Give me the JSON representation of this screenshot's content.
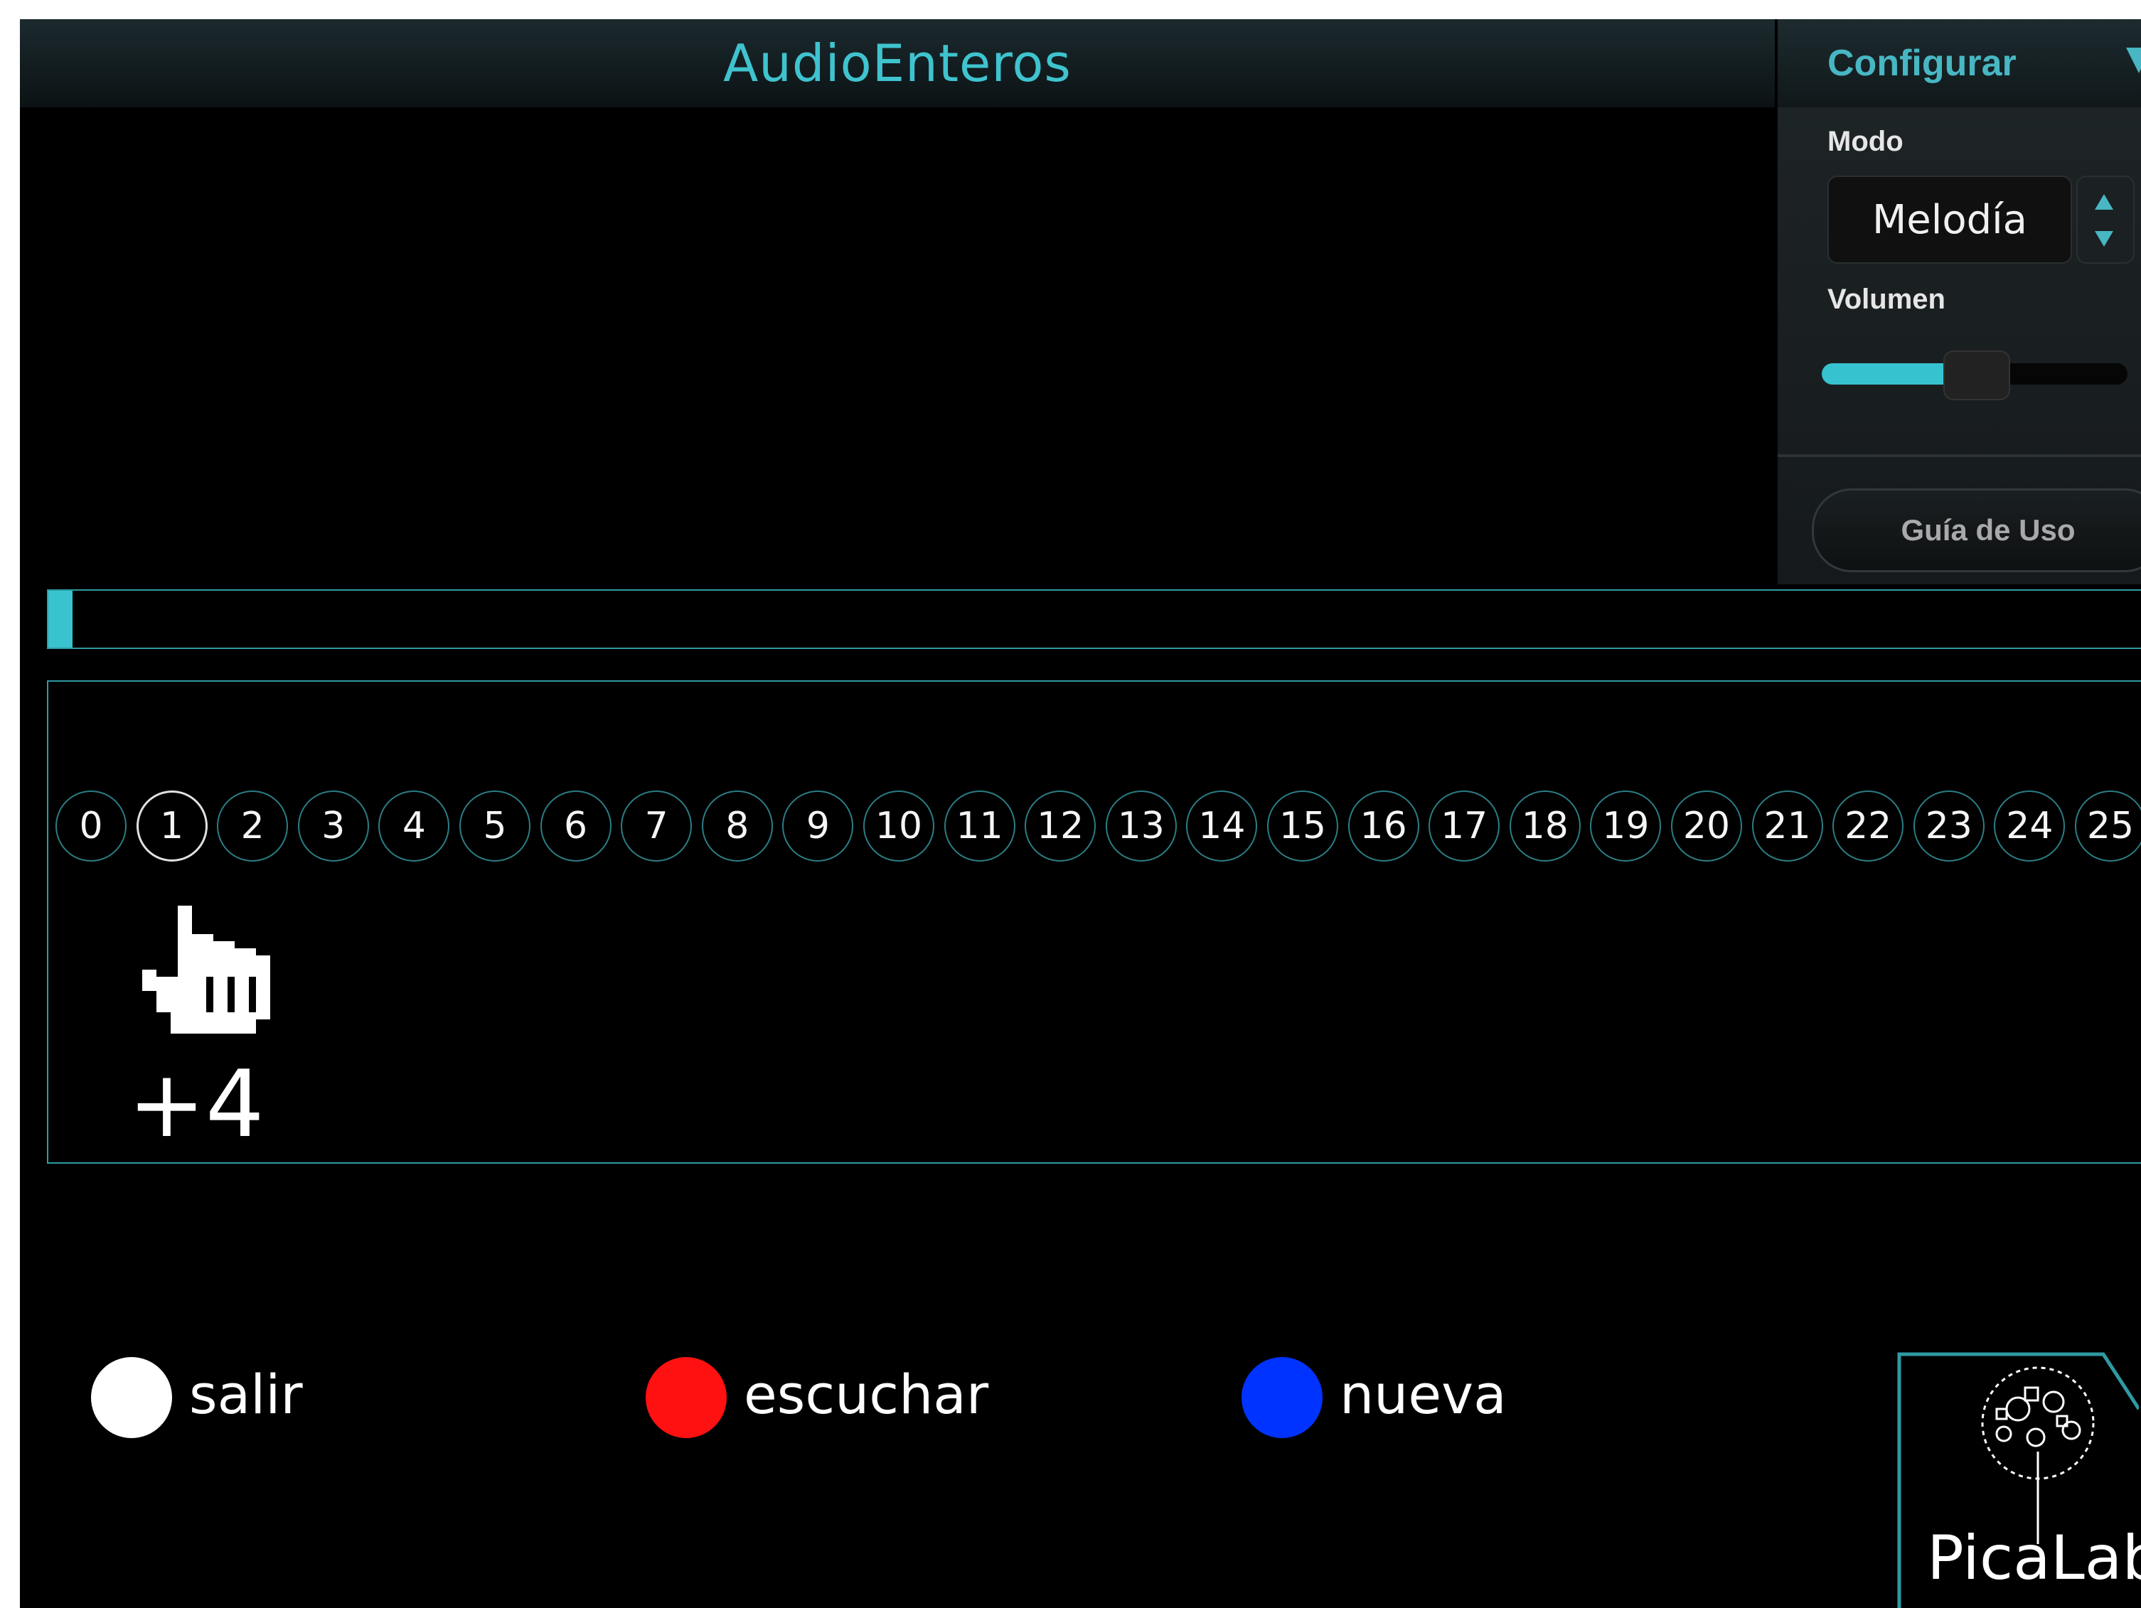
{
  "app": {
    "title": "AudioEnteros"
  },
  "config": {
    "title": "Configurar",
    "mode_label": "Modo",
    "mode_value": "Melodía",
    "volume_label": "Volumen",
    "volume_fraction": 0.42,
    "guide_button": "Guía de Uso"
  },
  "progress": {
    "fraction": 0.006
  },
  "number_line": {
    "numbers": [
      "0",
      "1",
      "2",
      "3",
      "4",
      "5",
      "6",
      "7",
      "8",
      "9",
      "10",
      "11",
      "12",
      "13",
      "14",
      "15",
      "16",
      "17",
      "18",
      "19",
      "20",
      "21",
      "22",
      "23",
      "24",
      "25"
    ],
    "selected": 1,
    "offset_label": "+4"
  },
  "controls": {
    "exit_label": "salir",
    "listen_label": "escuchar",
    "new_label": "nueva",
    "exit_color": "#ffffff",
    "listen_color": "#ff1111",
    "new_color": "#0033ff"
  },
  "logo": {
    "text": "PicaLab"
  },
  "colors": {
    "accent": "#3fc3cf",
    "frame": "#2f9aa3"
  },
  "icons": {
    "pointer": "hand-pointer-icon",
    "logo": "tree-icon"
  }
}
